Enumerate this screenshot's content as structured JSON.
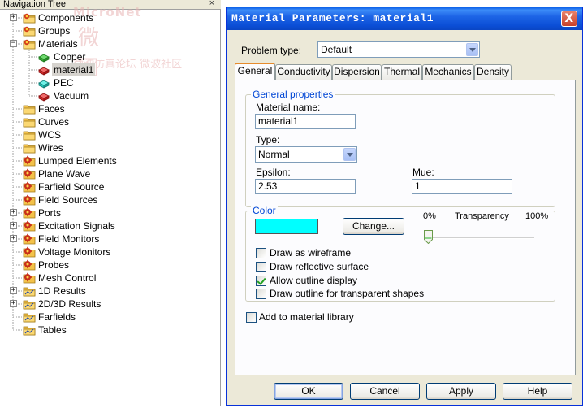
{
  "nav": {
    "header": "Navigation Tree",
    "close_glyph": "×",
    "items": [
      {
        "label": "Components"
      },
      {
        "label": "Groups"
      },
      {
        "label": "Materials"
      },
      {
        "label": "Copper"
      },
      {
        "label": "material1"
      },
      {
        "label": "PEC"
      },
      {
        "label": "Vacuum"
      },
      {
        "label": "Faces"
      },
      {
        "label": "Curves"
      },
      {
        "label": "WCS"
      },
      {
        "label": "Wires"
      },
      {
        "label": "Lumped Elements"
      },
      {
        "label": "Plane Wave"
      },
      {
        "label": "Farfield Source"
      },
      {
        "label": "Field Sources"
      },
      {
        "label": "Ports"
      },
      {
        "label": "Excitation Signals"
      },
      {
        "label": "Field Monitors"
      },
      {
        "label": "Voltage Monitors"
      },
      {
        "label": "Probes"
      },
      {
        "label": "Mesh Control"
      },
      {
        "label": "1D Results"
      },
      {
        "label": "2D/3D Results"
      },
      {
        "label": "Farfields"
      },
      {
        "label": "Tables"
      }
    ],
    "watermark": {
      "en": "MicroNet",
      "cn": "微 网",
      "sub": "微波仿真论坛 微波社区"
    }
  },
  "dialog": {
    "title": "Material Parameters: material1",
    "close_glyph": "X",
    "problem_type_label": "Problem type:",
    "problem_type_value": "Default",
    "tabs": [
      "General",
      "Conductivity",
      "Dispersion",
      "Thermal",
      "Mechanics",
      "Density"
    ],
    "general": {
      "group_title": "General properties",
      "material_name_label": "Material name:",
      "material_name_value": "material1",
      "type_label": "Type:",
      "type_value": "Normal",
      "epsilon_label": "Epsilon:",
      "epsilon_value": "2.53",
      "mue_label": "Mue:",
      "mue_value": "1"
    },
    "color": {
      "group_title": "Color",
      "swatch": "#00ffff",
      "change_button": "Change...",
      "transparency_min": "0%",
      "transparency_label": "Transparency",
      "transparency_max": "100%",
      "transparency_value": 0,
      "checks": [
        {
          "label": "Draw as wireframe",
          "checked": false
        },
        {
          "label": "Draw reflective surface",
          "checked": false
        },
        {
          "label": "Allow outline display",
          "checked": true
        },
        {
          "label": "Draw outline for transparent shapes",
          "checked": false
        }
      ]
    },
    "add_to_library": {
      "label": "Add to material library",
      "checked": false
    },
    "buttons": {
      "ok": "OK",
      "cancel": "Cancel",
      "apply": "Apply",
      "help": "Help"
    }
  }
}
